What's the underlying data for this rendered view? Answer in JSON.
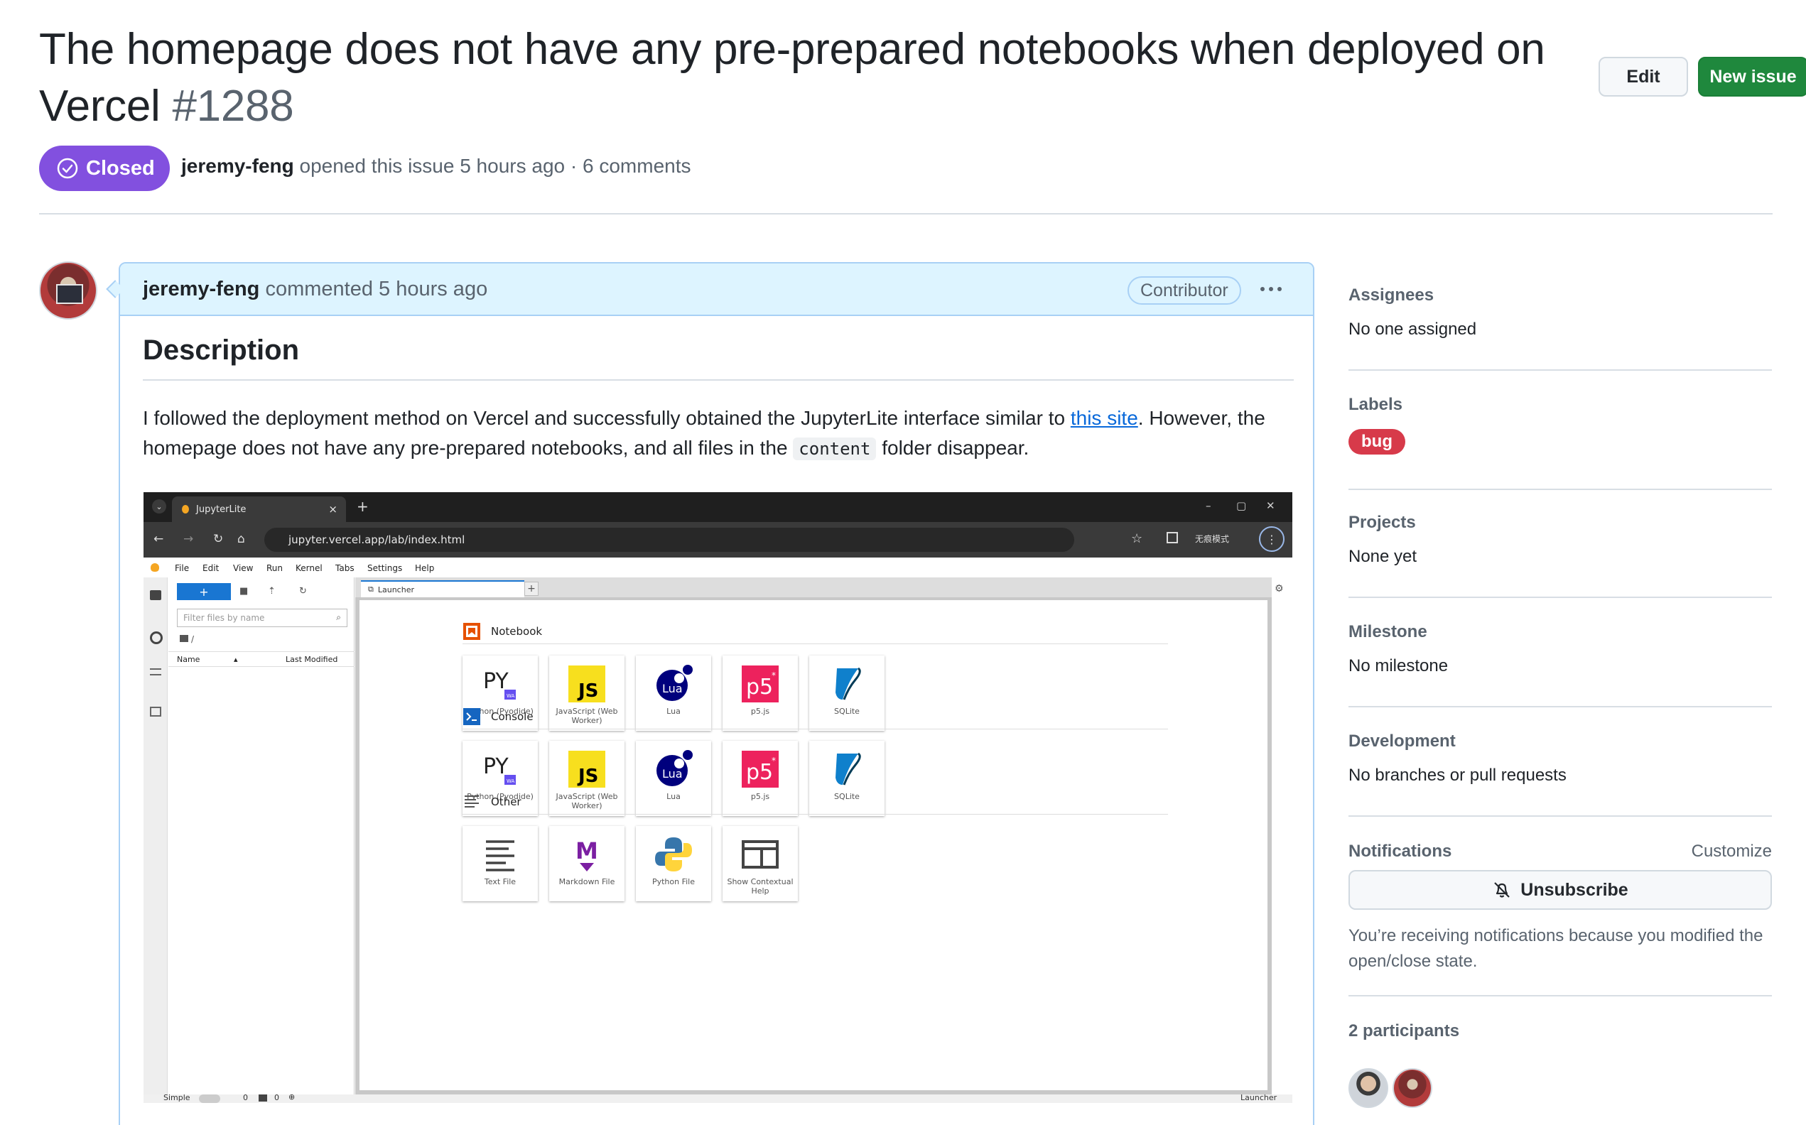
{
  "issue": {
    "title": "The homepage does not have any pre-prepared notebooks when deployed on Vercel",
    "number": "#1288",
    "state": "Closed",
    "author": "jeremy-feng",
    "opened_text": "opened this issue 5 hours ago",
    "separator": "·",
    "comments_count": "6 comments"
  },
  "header_actions": {
    "edit_label": "Edit",
    "new_issue_label": "New issue"
  },
  "comment": {
    "author": "jeremy-feng",
    "meta": "commented 5 hours ago",
    "role_badge": "Contributor",
    "heading": "Description",
    "text_1": "I followed the deployment method on Vercel and successfully obtained the JupyterLite interface similar to ",
    "link_text": "this site",
    "text_2": ". However, the homepage does not have any pre-prepared notebooks, and all files in the ",
    "code": "content",
    "text_3": " folder disappear."
  },
  "screenshot": {
    "browser_tab_title": "JupyterLite",
    "url": "jupyter.vercel.app/lab/index.html",
    "guest_label": "无痕模式",
    "menu": [
      "File",
      "Edit",
      "View",
      "Run",
      "Kernel",
      "Tabs",
      "Settings",
      "Help"
    ],
    "new_button": "+",
    "filter_placeholder": "Filter files by name",
    "breadcrumb": "/",
    "col_name": "Name",
    "col_modified": "Last Modified",
    "launcher_tab": "Launcher",
    "sections": [
      {
        "title": "Notebook",
        "items": [
          "Python (Pyodide)",
          "JavaScript (Web Worker)",
          "Lua",
          "p5.js",
          "SQLite"
        ]
      },
      {
        "title": "Console",
        "items": [
          "Python (Pyodide)",
          "JavaScript (Web Worker)",
          "Lua",
          "p5.js",
          "SQLite"
        ]
      },
      {
        "title": "Other",
        "items": [
          "Text File",
          "Markdown File",
          "Python File",
          "Show Contextual Help"
        ]
      }
    ],
    "status_simple": "Simple",
    "status_zero_1": "0",
    "status_zero_2": "0",
    "status_right": "Launcher"
  },
  "sidebar": {
    "assignees_title": "Assignees",
    "assignees_value": "No one assigned",
    "labels_title": "Labels",
    "label_bug": "bug",
    "projects_title": "Projects",
    "projects_value": "None yet",
    "milestone_title": "Milestone",
    "milestone_value": "No milestone",
    "development_title": "Development",
    "development_value": "No branches or pull requests",
    "notifications_title": "Notifications",
    "customize": "Customize",
    "unsubscribe": "Unsubscribe",
    "notif_reason": "You’re receiving notifications because you modified the open/close state.",
    "participants": "2 participants"
  },
  "colors": {
    "closed": "#8250df",
    "green": "#1f883d",
    "link": "#0969da",
    "bug": "#d73a4a"
  }
}
